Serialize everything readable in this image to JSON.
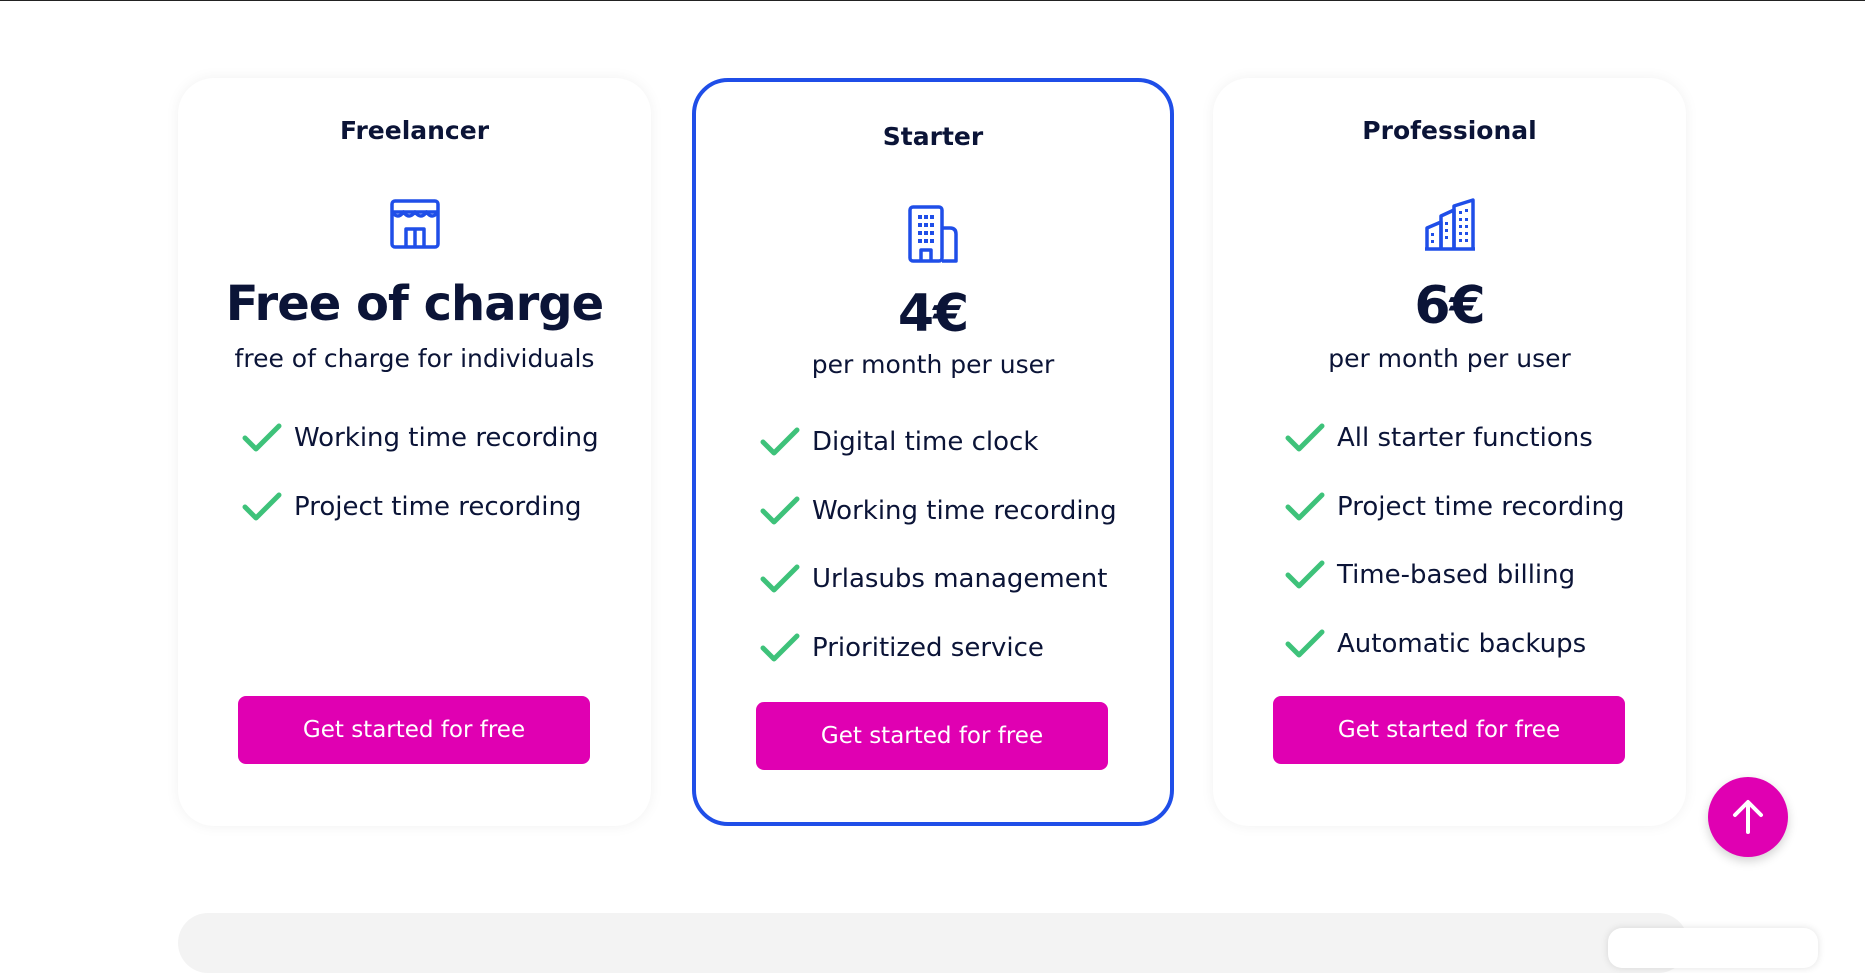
{
  "plans": [
    {
      "name": "Freelancer",
      "icon": "storefront-icon",
      "price": "Free of charge",
      "price_note": "free of charge for individuals",
      "features": [
        "Working time recording",
        "Project time recording"
      ],
      "cta": "Get started for free"
    },
    {
      "name": "Starter",
      "icon": "office-building-icon",
      "price": "4€",
      "price_note": "per month per user",
      "features": [
        "Digital time clock",
        "Working time recording",
        "Urlasubs management",
        "Prioritized service"
      ],
      "cta": "Get started for free",
      "highlighted": true
    },
    {
      "name": "Professional",
      "icon": "city-buildings-icon",
      "price": "6€",
      "price_note": "per month per user",
      "features": [
        "All starter functions",
        "Project time recording",
        "Time-based billing",
        "Automatic backups"
      ],
      "cta": "Get started for free"
    }
  ],
  "scroll_top": {
    "icon": "arrow-up-icon"
  },
  "colors": {
    "accent": "#e000b2",
    "highlight_border": "#1f4ee8",
    "icon_blue": "#1f4ee8",
    "check_green": "#3ec27a",
    "text_dark": "#0b1437"
  }
}
